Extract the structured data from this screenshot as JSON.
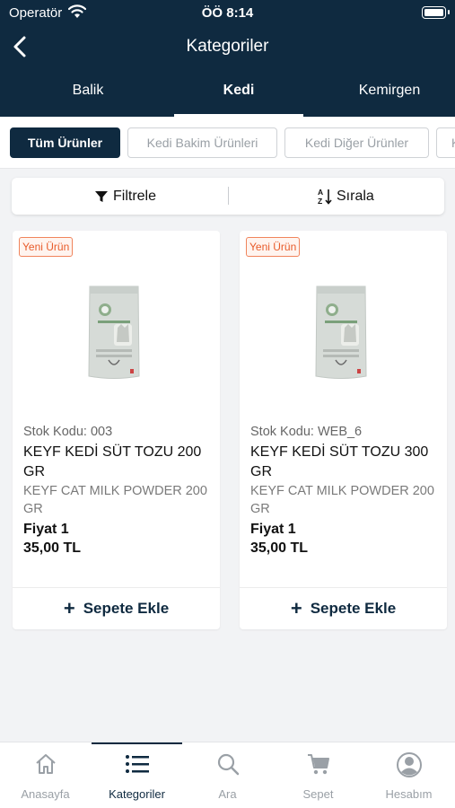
{
  "status_bar": {
    "carrier": "Operatör",
    "time": "ÖÖ 8:14"
  },
  "header": {
    "title": "Kategoriler"
  },
  "category_tabs": [
    {
      "label": "Balik"
    },
    {
      "label": "Kedi",
      "active": true
    },
    {
      "label": "Kemirgen"
    }
  ],
  "filter_chips": [
    {
      "label": "Tüm Ürünler",
      "active": true
    },
    {
      "label": "Kedi Bakim Ürünleri"
    },
    {
      "label": "Kedi Diğer Ürünler"
    },
    {
      "label": "K"
    }
  ],
  "toolbar": {
    "filter_label": "Filtrele",
    "sort_label": "Sırala"
  },
  "products": [
    {
      "badge": "Yeni Ürün",
      "stock_code": "Stok Kodu: 003",
      "name": "KEYF KEDİ SÜT TOZU 200 GR",
      "name_en": "KEYF CAT MILK POWDER 200 GR",
      "price_label": "Fiyat 1",
      "price": "35,00 TL",
      "add_label": "Sepete Ekle"
    },
    {
      "badge": "Yeni Ürün",
      "stock_code": "Stok Kodu: WEB_6",
      "name": "KEYF KEDİ SÜT TOZU 300 GR",
      "name_en": "KEYF CAT MILK POWDER 200 GR",
      "price_label": "Fiyat 1",
      "price": "35,00 TL",
      "add_label": "Sepete Ekle"
    }
  ],
  "tab_bar": [
    {
      "label": "Anasayfa",
      "icon": "home-icon"
    },
    {
      "label": "Kategoriler",
      "icon": "list-icon",
      "active": true
    },
    {
      "label": "Ara",
      "icon": "search-icon"
    },
    {
      "label": "Sepet",
      "icon": "cart-icon"
    },
    {
      "label": "Hesabım",
      "icon": "account-icon"
    }
  ],
  "colors": {
    "primary": "#0f2a40",
    "badge": "#e85b2a",
    "background": "#f2f3f5"
  }
}
